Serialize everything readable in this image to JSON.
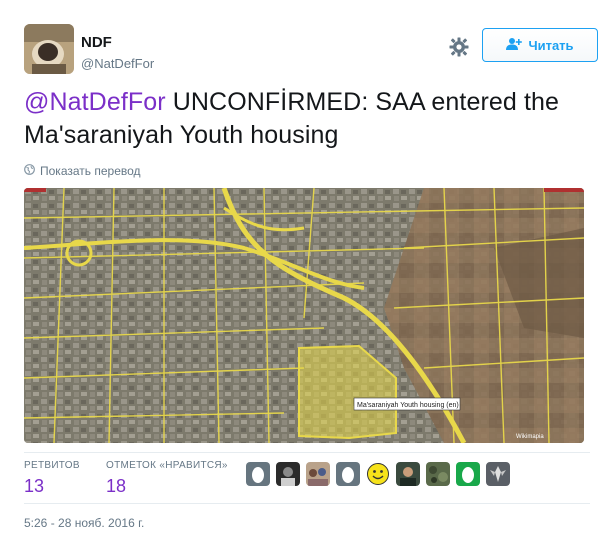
{
  "user": {
    "name": "NDF",
    "handle": "@NatDefFor"
  },
  "follow_button": {
    "label": "Читать",
    "icon": "add-user-icon"
  },
  "settings": {
    "icon": "gear-icon"
  },
  "tweet": {
    "mention": "@NatDefFor",
    "text": " UNCONFİRMED: SAA entered the Ma'saraniyah Youth housing"
  },
  "translate": {
    "label": "Показать перевод",
    "icon": "globe-icon"
  },
  "media": {
    "map_label": "Ma'saraniyah Youth housing (en)",
    "attribution": "Wikimapia"
  },
  "stats": {
    "retweets_label": "РЕТВИТОВ",
    "retweets": "13",
    "likes_label": "ОТМЕТОК «НРАВИТСЯ»",
    "likes": "18"
  },
  "likers": [
    "egg",
    "person-dark",
    "person-group",
    "egg",
    "smiley",
    "person-photo",
    "camo",
    "green-egg",
    "emblem"
  ],
  "timestamp": "5:26 - 28 нояб. 2016 г.",
  "colors": {
    "mention": "#7b2fc8",
    "accent": "#1da1f2",
    "muted": "#657786"
  }
}
